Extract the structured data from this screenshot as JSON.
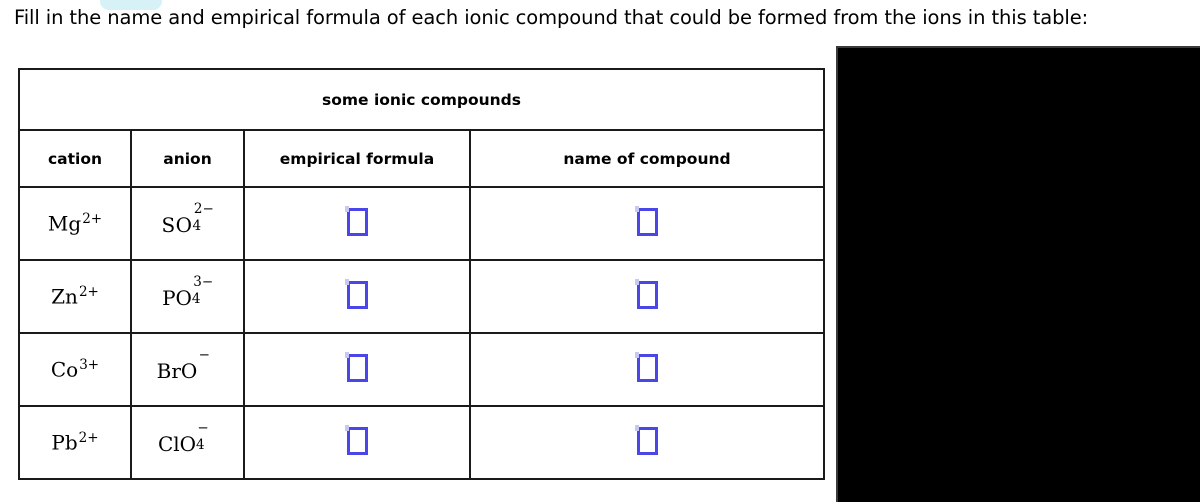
{
  "prompt": {
    "text": "Fill in the name and empirical formula of each ionic compound that could be formed from the ions in this table:"
  },
  "table": {
    "title": "some ionic compounds",
    "columns": [
      {
        "key": "cation",
        "label": "cation"
      },
      {
        "key": "anion",
        "label": "anion"
      },
      {
        "key": "formula",
        "label": "empirical formula"
      },
      {
        "key": "name",
        "label": "name of compound"
      }
    ],
    "rows": [
      {
        "cation": {
          "symbol": "Mg",
          "charge": "2+",
          "subscript": ""
        },
        "anion": {
          "symbol": "SO",
          "charge": "2−",
          "subscript": "4"
        },
        "formula_value": "",
        "name_value": ""
      },
      {
        "cation": {
          "symbol": "Zn",
          "charge": "2+",
          "subscript": ""
        },
        "anion": {
          "symbol": "PO",
          "charge": "3−",
          "subscript": "4"
        },
        "formula_value": "",
        "name_value": ""
      },
      {
        "cation": {
          "symbol": "Co",
          "charge": "3+",
          "subscript": ""
        },
        "anion": {
          "symbol": "BrO",
          "charge": "−",
          "subscript": ""
        },
        "formula_value": "",
        "name_value": ""
      },
      {
        "cation": {
          "symbol": "Pb",
          "charge": "2+",
          "subscript": ""
        },
        "anion": {
          "symbol": "ClO",
          "charge": "−",
          "subscript": "4"
        },
        "formula_value": "",
        "name_value": ""
      }
    ]
  },
  "colors": {
    "answer_box_border": "#4a46e8",
    "table_border": "#1a1a1a",
    "highlight_pill": "#d6f2f6",
    "panel_background": "#000000"
  }
}
